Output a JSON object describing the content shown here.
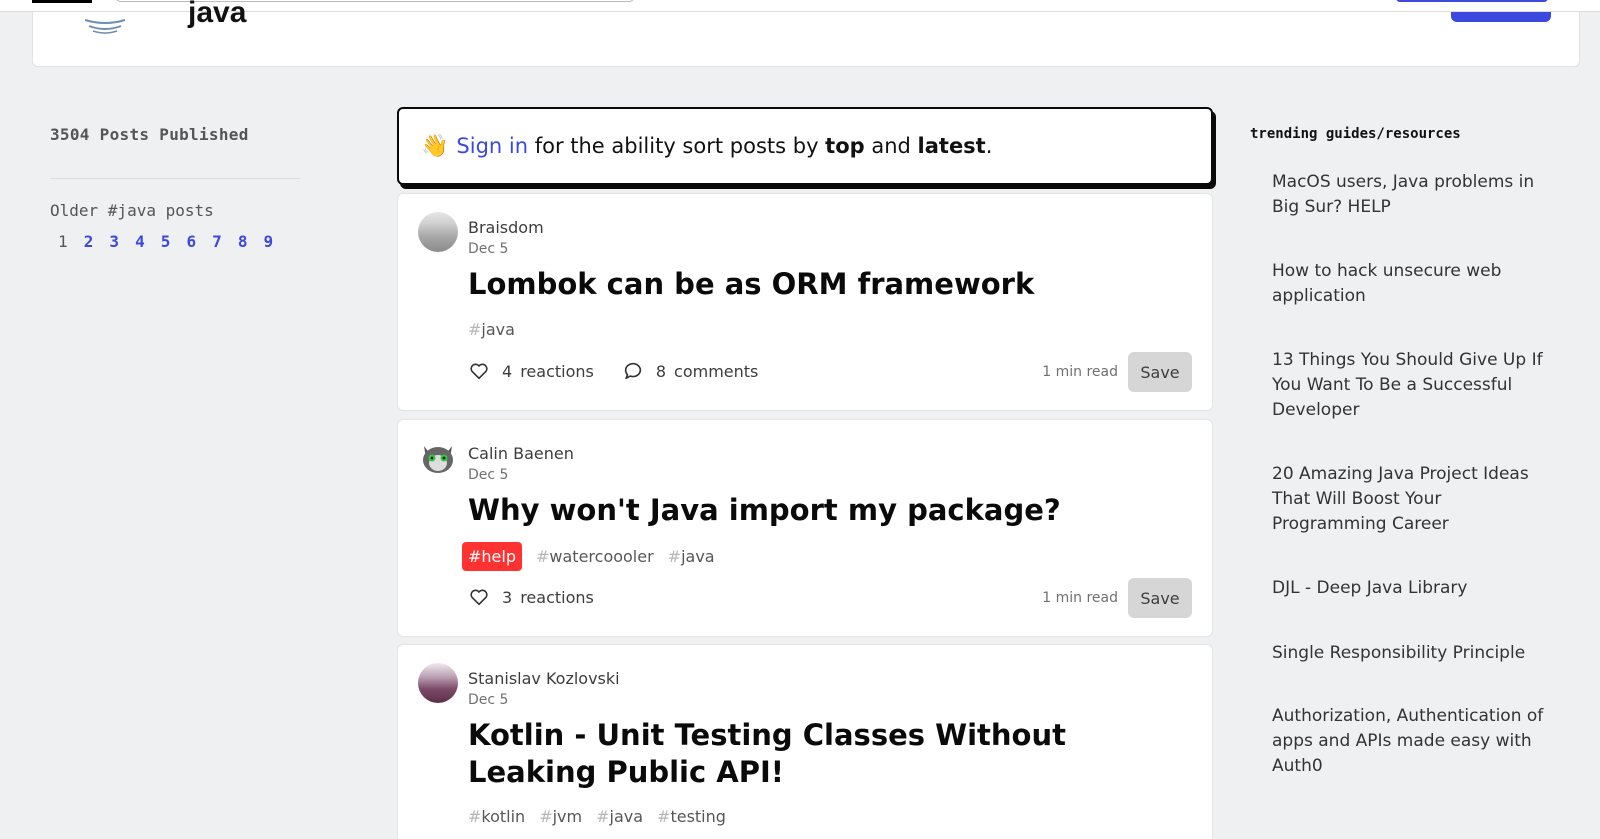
{
  "tag_header": {
    "title_fragment": "java"
  },
  "left": {
    "posts_published": "3504 Posts Published",
    "older_title": "Older #java posts",
    "pages": [
      "1",
      "2",
      "3",
      "4",
      "5",
      "6",
      "7",
      "8",
      "9"
    ],
    "current_page": "1"
  },
  "banner": {
    "wave": "👋",
    "sign_in": "Sign in",
    "text1": " for the ability sort posts by ",
    "top": "top",
    "and": " and ",
    "latest": "latest",
    "period": "."
  },
  "posts": [
    {
      "author": "Braisdom",
      "date": "Dec 5",
      "title": "Lombok can be as ORM framework",
      "tags": [
        {
          "hash": "#",
          "name": "java"
        }
      ],
      "reactions_count": "4",
      "reactions_label": "reactions",
      "comments_count": "8",
      "comments_label": "comments",
      "read_time": "1 min read",
      "save": "Save"
    },
    {
      "author": "Calin Baenen",
      "date": "Dec 5",
      "title": "Why won't Java import my package?",
      "help_tag": "#help",
      "tags": [
        {
          "hash": "#",
          "name": "watercoooler"
        },
        {
          "hash": "#",
          "name": "java"
        }
      ],
      "reactions_count": "3",
      "reactions_label": "reactions",
      "read_time": "1 min read",
      "save": "Save"
    },
    {
      "author": "Stanislav Kozlovski",
      "date": "Dec 5",
      "title": "Kotlin - Unit Testing Classes Without Leaking Public API!",
      "tags": [
        {
          "hash": "#",
          "name": "kotlin"
        },
        {
          "hash": "#",
          "name": "jvm"
        },
        {
          "hash": "#",
          "name": "java"
        },
        {
          "hash": "#",
          "name": "testing"
        }
      ]
    }
  ],
  "right": {
    "heading": "trending guides/resources",
    "items": [
      "MacOS users, Java problems in Big Sur? HELP",
      "How to hack unsecure web application",
      "13 Things You Should Give Up If You Want To Be a Successful Developer",
      "20 Amazing Java Project Ideas That Will Boost Your Programming Career",
      "DJL - Deep Java Library",
      "Single Responsibility Principle",
      "Authorization, Authentication of apps and APIs made easy with Auth0"
    ]
  },
  "colors": {
    "accent": "#3b49df",
    "help_tag": "#ff3232",
    "background": "#eef0f1"
  }
}
